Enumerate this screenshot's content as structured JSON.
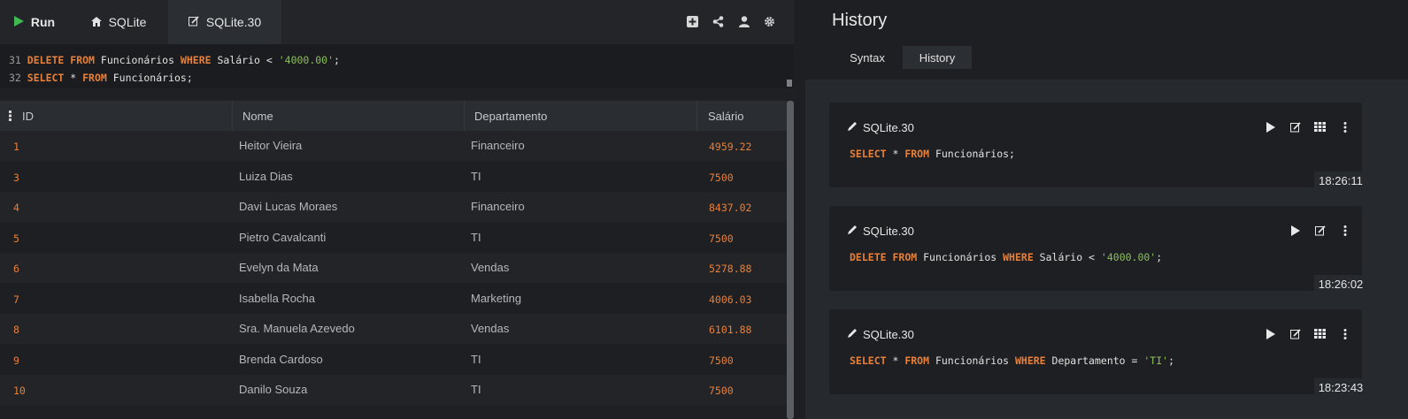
{
  "toolbar": {
    "run_label": "Run",
    "tab_sqlite": "SQLite",
    "tab_sqlite30": "SQLite.30",
    "icons": [
      "add-icon",
      "share-icon",
      "user-icon",
      "gear-icon"
    ]
  },
  "editor": {
    "lines": [
      {
        "num": "31",
        "parts": [
          {
            "t": "DELETE",
            "c": "kw"
          },
          {
            "t": " "
          },
          {
            "t": "FROM",
            "c": "kw"
          },
          {
            "t": " Funcionários "
          },
          {
            "t": "WHERE",
            "c": "kw"
          },
          {
            "t": " Salário < "
          },
          {
            "t": "'4000.00'",
            "c": "str"
          },
          {
            "t": ";"
          }
        ]
      },
      {
        "num": "32",
        "parts": [
          {
            "t": "SELECT",
            "c": "kw"
          },
          {
            "t": " * "
          },
          {
            "t": "FROM",
            "c": "kw"
          },
          {
            "t": " Funcionários;"
          }
        ]
      }
    ]
  },
  "grid": {
    "columns": [
      "ID",
      "Nome",
      "Departamento",
      "Salário"
    ],
    "rows": [
      [
        "1",
        "Heitor Vieira",
        "Financeiro",
        "4959.22"
      ],
      [
        "3",
        "Luiza Dias",
        "TI",
        "7500"
      ],
      [
        "4",
        "Davi Lucas Moraes",
        "Financeiro",
        "8437.02"
      ],
      [
        "5",
        "Pietro Cavalcanti",
        "TI",
        "7500"
      ],
      [
        "6",
        "Evelyn da Mata",
        "Vendas",
        "5278.88"
      ],
      [
        "7",
        "Isabella Rocha",
        "Marketing",
        "4006.03"
      ],
      [
        "8",
        "Sra. Manuela Azevedo",
        "Vendas",
        "6101.88"
      ],
      [
        "9",
        "Brenda Cardoso",
        "TI",
        "7500"
      ],
      [
        "10",
        "Danilo Souza",
        "TI",
        "7500"
      ]
    ]
  },
  "history": {
    "title": "History",
    "tabs": [
      "Syntax",
      "History"
    ],
    "active_tab": "History",
    "entries": [
      {
        "db": "SQLite.30",
        "time": "18:26:11",
        "parts": [
          {
            "t": "SELECT",
            "c": "kw"
          },
          {
            "t": " * "
          },
          {
            "t": "FROM",
            "c": "kw"
          },
          {
            "t": " Funcionários;"
          }
        ],
        "icons": [
          "play-icon",
          "edit-icon",
          "grid-icon",
          "more-icon"
        ]
      },
      {
        "db": "SQLite.30",
        "time": "18:26:02",
        "parts": [
          {
            "t": "DELETE",
            "c": "kw"
          },
          {
            "t": " "
          },
          {
            "t": "FROM",
            "c": "kw"
          },
          {
            "t": " Funcionários "
          },
          {
            "t": "WHERE",
            "c": "kw"
          },
          {
            "t": " Salário < "
          },
          {
            "t": "'4000.00'",
            "c": "str"
          },
          {
            "t": ";"
          }
        ],
        "icons": [
          "play-icon",
          "edit-icon",
          "more-icon"
        ]
      },
      {
        "db": "SQLite.30",
        "time": "18:23:43",
        "parts": [
          {
            "t": "SELECT",
            "c": "kw"
          },
          {
            "t": " * "
          },
          {
            "t": "FROM",
            "c": "kw"
          },
          {
            "t": " Funcionários "
          },
          {
            "t": "WHERE",
            "c": "kw"
          },
          {
            "t": " Departamento = "
          },
          {
            "t": "'TI'",
            "c": "str"
          },
          {
            "t": ";"
          }
        ],
        "icons": [
          "play-icon",
          "edit-icon",
          "grid-icon",
          "more-icon"
        ]
      }
    ]
  },
  "colors": {
    "keyword": "#e8803a",
    "string": "#8cbf5c",
    "run_icon": "#3fb950"
  }
}
